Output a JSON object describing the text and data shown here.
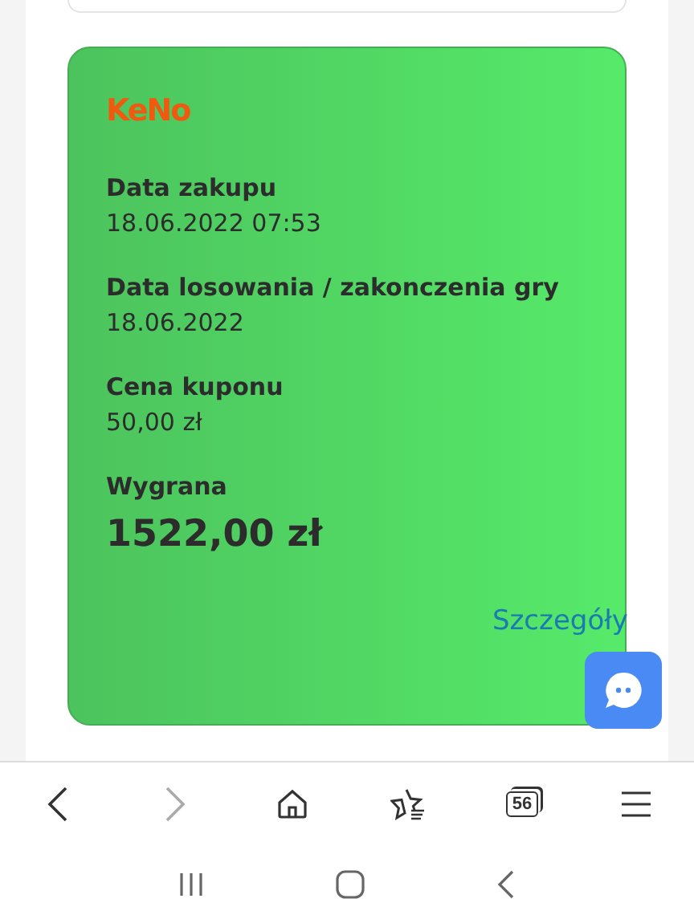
{
  "logo": "KeNo",
  "fields": [
    {
      "label": "Data zakupu",
      "value": "18.06.2022 07:53",
      "kind": "normal"
    },
    {
      "label": "Data losowania / zakonczenia gry",
      "value": "18.06.2022",
      "kind": "normal"
    },
    {
      "label": "Cena kuponu",
      "value": "50,00 zł",
      "kind": "normal"
    },
    {
      "label": "Wygrana",
      "value": "1522,00 zł",
      "kind": "prize"
    }
  ],
  "details_link": "Szczegóły",
  "browser_bar": {
    "back_disabled": false,
    "forward_disabled": true,
    "tab_count": "56"
  }
}
